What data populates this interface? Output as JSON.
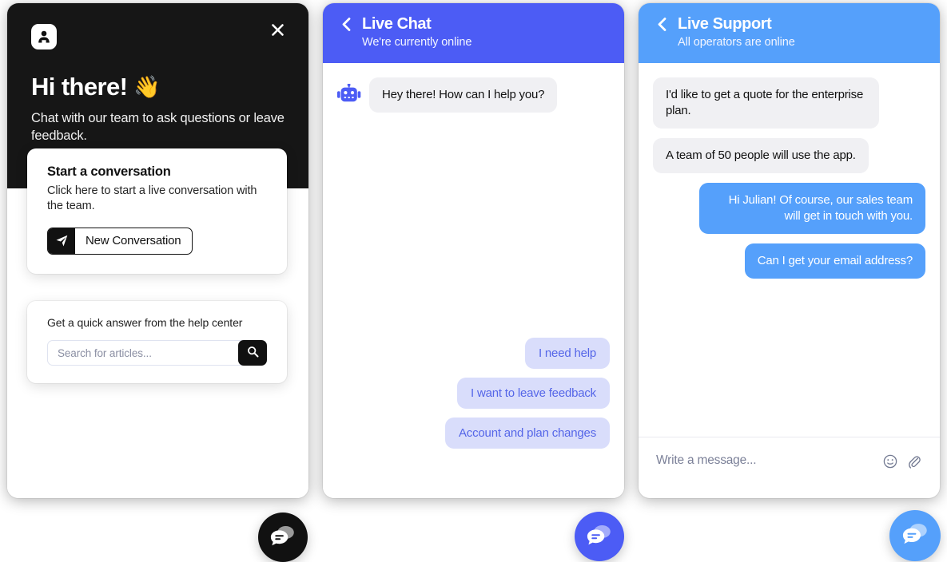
{
  "welcome_panel": {
    "logo_icon": "person-avatar-logo",
    "close_icon": "close-icon",
    "title": "Hi there!",
    "title_emoji": "👋",
    "subtitle": "Chat with our team to ask questions or leave feedback.",
    "start_card": {
      "heading": "Start a conversation",
      "description": "Click here to start a live conversation with the team.",
      "button_label": "New Conversation",
      "button_icon": "paper-plane-icon"
    },
    "help_card": {
      "label": "Get a quick answer from the help center",
      "search_placeholder": "Search for articles...",
      "search_value": "",
      "search_icon": "search-icon"
    },
    "colors": {
      "header_bg": "#161616",
      "accent": "#111111"
    }
  },
  "live_chat_panel": {
    "back_icon": "chevron-left-icon",
    "title": "Live Chat",
    "status": "We're currently online",
    "bot_icon": "robot-icon",
    "messages": [
      {
        "direction": "in",
        "text": "Hey there! How can I help you?"
      }
    ],
    "quick_replies": [
      "I need help",
      "I want to leave feedback",
      "Account and plan changes"
    ],
    "colors": {
      "header_bg": "#4c5cf5",
      "quick_reply_bg": "#d9ddfb",
      "quick_reply_text": "#5566e8",
      "bubble_in_bg": "#f0f0f3"
    }
  },
  "live_support_panel": {
    "back_icon": "chevron-left-icon",
    "title": "Live Support",
    "status": "All operators are online",
    "messages": [
      {
        "direction": "in",
        "text": "I'd like to get a quote for the enterprise plan."
      },
      {
        "direction": "in",
        "text": "A team of 50 people will use the app."
      },
      {
        "direction": "out",
        "text": "Hi Julian! Of course, our sales team will get in touch with you."
      },
      {
        "direction": "out",
        "text": "Can I get your email address?"
      }
    ],
    "composer": {
      "placeholder": "Write a message...",
      "value": "",
      "emoji_icon": "smiley-icon",
      "attach_icon": "paperclip-icon"
    },
    "colors": {
      "header_bg": "#55a0fb",
      "bubble_out_bg": "#55a0fb",
      "bubble_in_bg": "#f0f0f3"
    }
  },
  "launchers": [
    {
      "name": "chat-launcher-dark",
      "icon": "chat-bubbles-icon",
      "color": "#111111"
    },
    {
      "name": "chat-launcher-indigo",
      "icon": "chat-bubbles-icon",
      "color": "#4c5cf5"
    },
    {
      "name": "chat-launcher-blue",
      "icon": "chat-bubbles-icon",
      "color": "#55a0fb"
    }
  ]
}
